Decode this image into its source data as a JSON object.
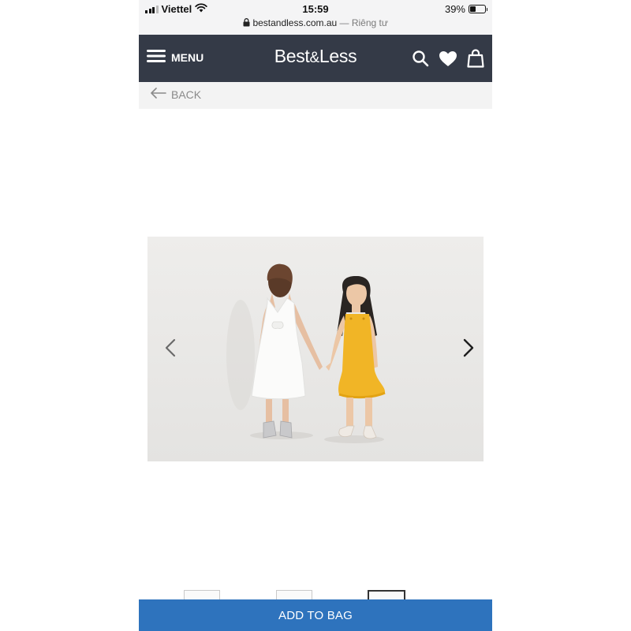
{
  "status_bar": {
    "carrier": "Viettel",
    "time": "15:59",
    "battery": "39%",
    "battery_level": 0.39,
    "url": "bestandless.com.au",
    "privacy": "— Riêng tư"
  },
  "header": {
    "menu_label": "MENU",
    "logo_part1": "Best",
    "logo_amp": "&",
    "logo_part2": "Less",
    "icons": [
      "search-icon",
      "heart-icon",
      "bag-icon"
    ],
    "background": "#343a47"
  },
  "back": {
    "label": "BACK"
  },
  "gallery": {
    "prev_icon": "chevron-left-icon",
    "next_icon": "chevron-right-icon",
    "thumbnail_count": 3,
    "selected_thumbnail": 3
  },
  "cta": {
    "add_to_bag": "ADD TO BAG",
    "color": "#2e73bd"
  }
}
